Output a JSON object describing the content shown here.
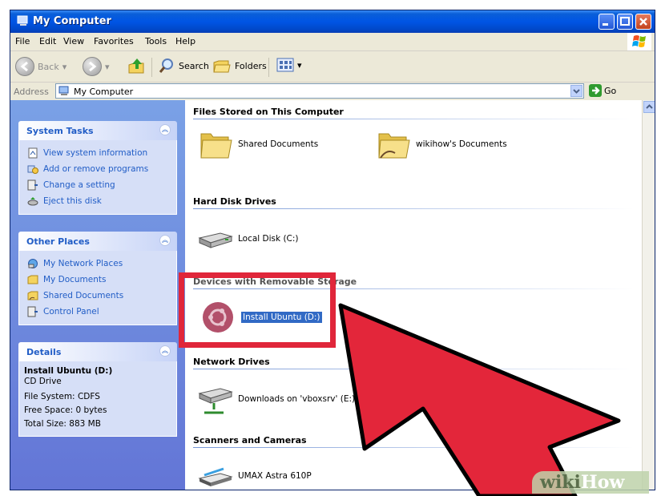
{
  "window": {
    "title": "My Computer"
  },
  "menu": [
    "File",
    "Edit",
    "View",
    "Favorites",
    "Tools",
    "Help"
  ],
  "toolbar": {
    "back": "Back",
    "search": "Search",
    "folders": "Folders"
  },
  "address": {
    "label": "Address",
    "value": "My Computer",
    "go": "Go"
  },
  "system_tasks": {
    "title": "System Tasks",
    "items": [
      "View system information",
      "Add or remove programs",
      "Change a setting",
      "Eject this disk"
    ]
  },
  "other_places": {
    "title": "Other Places",
    "items": [
      "My Network Places",
      "My Documents",
      "Shared Documents",
      "Control Panel"
    ]
  },
  "details": {
    "title": "Details",
    "name": "Install Ubuntu (D:)",
    "type": "CD Drive",
    "filesystem": "File System: CDFS",
    "free": "Free Space: 0 bytes",
    "total": "Total Size: 883 MB"
  },
  "sections": {
    "files": "Files Stored on This Computer",
    "hdd": "Hard Disk Drives",
    "removable": "Devices with Removable Storage",
    "network": "Network Drives",
    "scanners": "Scanners and Cameras"
  },
  "items": {
    "shared_docs": "Shared Documents",
    "wikihow_docs": "wikihow's Documents",
    "local_disk": "Local Disk (C:)",
    "ubuntu": "Install Ubuntu (D:)",
    "network_drive": "Downloads on 'vboxsrv' (E:)",
    "scanner": "UMAX Astra 610P"
  },
  "watermark": {
    "part1": "wiki",
    "part2": "How"
  },
  "colors": {
    "highlight": "#e0263a",
    "titlebar": "#0055e5",
    "link": "#215dc6"
  }
}
